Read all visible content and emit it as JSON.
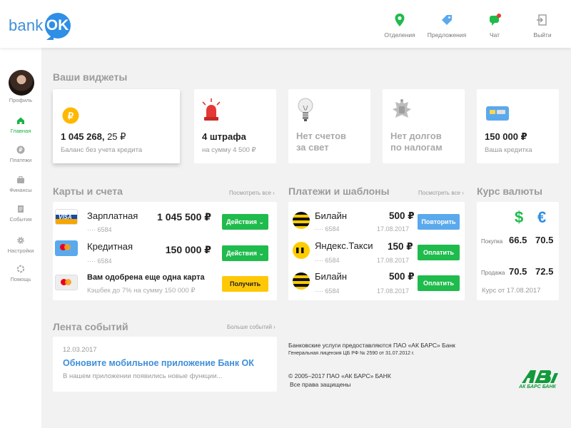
{
  "header": {
    "logo_text": "bank",
    "logo_badge": "OK",
    "nav": [
      {
        "label": "Отделения",
        "icon": "location-pin-icon"
      },
      {
        "label": "Предложения",
        "icon": "tag-icon"
      },
      {
        "label": "Чат",
        "icon": "chat-icon"
      },
      {
        "label": "Выйти",
        "icon": "logout-icon"
      }
    ]
  },
  "sidebar": {
    "profile_label": "Профиль",
    "items": [
      {
        "label": "Главная",
        "icon": "home-icon",
        "active": true
      },
      {
        "label": "Платежи",
        "icon": "ruble-icon"
      },
      {
        "label": "Финансы",
        "icon": "briefcase-icon"
      },
      {
        "label": "События",
        "icon": "document-icon"
      },
      {
        "label": "Настройки",
        "icon": "gear-icon"
      },
      {
        "label": "Помощь",
        "icon": "help-lifebuoy-icon"
      }
    ]
  },
  "widgets": {
    "title": "Ваши виджеты",
    "items": [
      {
        "icon": "ruble-coin-icon",
        "value_main": "1 045 268,",
        "value_cents": "25 ₽",
        "caption": "Баланс без учета кредита"
      },
      {
        "icon": "siren-icon",
        "value": "4 штрафа",
        "caption": "на сумму 4 500 ₽"
      },
      {
        "icon": "lightbulb-icon",
        "value_line1": "Нет счетов",
        "value_line2": "за свет"
      },
      {
        "icon": "coat-of-arms-icon",
        "value_line1": "Нет долгов",
        "value_line2": "по налогам"
      },
      {
        "icon": "credit-card-icon",
        "value": "150 000 ₽",
        "caption": "Ваша  кредитка"
      }
    ]
  },
  "accounts": {
    "title": "Карты и счета",
    "see_all": "Посмотреть все",
    "items": [
      {
        "name": "Зарплатная",
        "number": "···· 6584",
        "amount": "1 045 500 ₽",
        "action": "Действия",
        "card": "visa"
      },
      {
        "name": "Кредитная",
        "number": "···· 6584",
        "amount": "150 000 ₽",
        "action": "Действия",
        "card": "mastercard"
      },
      {
        "name": "Вам одобрена еще одна карта",
        "subtitle": "Кэшбек до 7% на сумму 150 000 ₽",
        "action": "Получить",
        "card": "mastercard"
      }
    ]
  },
  "payments": {
    "title": "Платежи и шаблоны",
    "see_all": "Посмотреть все",
    "items": [
      {
        "name": "Билайн",
        "number": "···· 6584",
        "amount": "500 ₽",
        "date": "17.08.2017",
        "action": "Повторить"
      },
      {
        "name": "Яндекс.Такси",
        "number": "···· 6584",
        "amount": "150 ₽",
        "date": "17.08.2017",
        "action": "Оплатить"
      },
      {
        "name": "Билайн",
        "number": "···· 6584",
        "amount": "500 ₽",
        "date": "17.08.2017",
        "action": "Оплатить"
      }
    ]
  },
  "currency": {
    "title": "Курс валюты",
    "usd_symbol": "$",
    "eur_symbol": "€",
    "buy_label": "Покупка",
    "sell_label": "Продажа",
    "buy_usd": "66.5",
    "buy_eur": "70.5",
    "sell_usd": "70.5",
    "sell_eur": "72.5",
    "rate_date": "Курс от 17.08.2017"
  },
  "feed": {
    "title": "Лента событий",
    "more": "Больше событий",
    "date": "12.03.2017",
    "headline": "Обновите мобильное приложение Банк ОК",
    "text": "В нашем приложении появились новые функции..."
  },
  "footer": {
    "line1": "Банковские услуги предоставляются ПАО «АК БАРС» Банк",
    "line2": "Генеральная лицензия ЦБ РФ № 2590 от 31.07.2012 г.",
    "line3": "© 2005–2017 ПАО «АК БАРС» БАНК",
    "line4": "Все права защищены",
    "bank_logo_text": "АК БАРС БАНК"
  },
  "colors": {
    "accent_green": "#1fbb4c",
    "accent_blue": "#2f8ee5",
    "accent_yellow": "#ffc807"
  }
}
